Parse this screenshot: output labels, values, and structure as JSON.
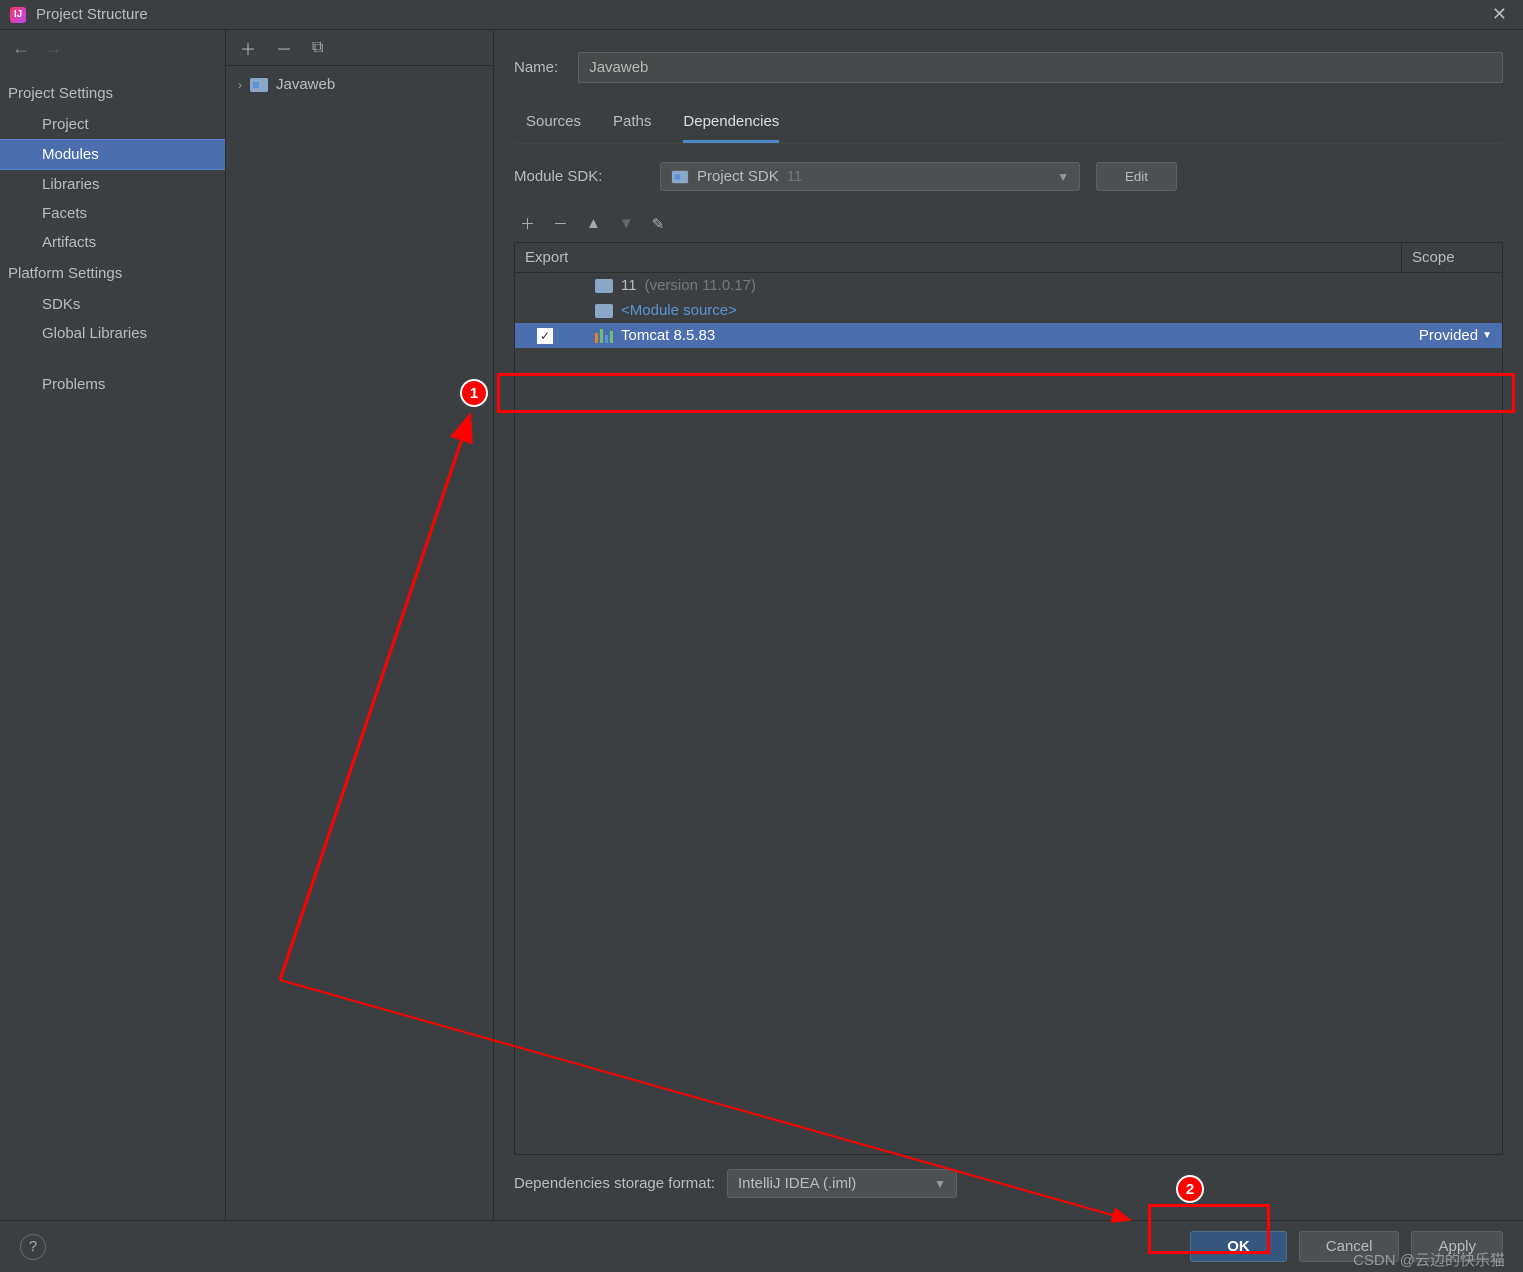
{
  "title": "Project Structure",
  "sidebar": {
    "project_settings_label": "Project Settings",
    "platform_settings_label": "Platform Settings",
    "items_project": [
      "Project",
      "Modules",
      "Libraries",
      "Facets",
      "Artifacts"
    ],
    "items_platform": [
      "SDKs",
      "Global Libraries"
    ],
    "problems_label": "Problems",
    "selected": "Modules"
  },
  "module_tree": {
    "root": "Javaweb"
  },
  "config": {
    "name_label": "Name:",
    "name_value": "Javaweb",
    "tabs": [
      "Sources",
      "Paths",
      "Dependencies"
    ],
    "active_tab": "Dependencies",
    "sdk_label": "Module SDK:",
    "sdk_name": "Project SDK",
    "sdk_version": "11",
    "sdk_edit": "Edit",
    "dep_header_export": "Export",
    "dep_header_scope": "Scope",
    "dep_rows": [
      {
        "icon": "folder",
        "text": "11",
        "suffix": "(version 11.0.17)",
        "link": false
      },
      {
        "icon": "folder",
        "text": "<Module source>",
        "link": true
      },
      {
        "icon": "bars",
        "text": "Tomcat 8.5.83",
        "checked": true,
        "selected": true,
        "scope": "Provided"
      }
    ],
    "storage_label": "Dependencies storage format:",
    "storage_value": "IntelliJ IDEA (.iml)"
  },
  "footer": {
    "ok": "OK",
    "cancel": "Cancel",
    "apply": "Apply"
  },
  "annotations": {
    "badge1": "1",
    "badge2": "2"
  },
  "watermark": "CSDN @云边的快乐猫"
}
